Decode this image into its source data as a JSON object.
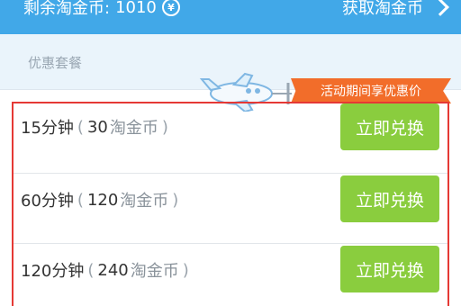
{
  "header": {
    "balance_label": "剩余淘金币:",
    "balance_value": "1010",
    "coin_icon": "yen-coin-icon",
    "get_coins_label": "获取淘金币",
    "arrow_icon": "chevron-right-icon"
  },
  "section": {
    "title": "优惠套餐",
    "promo_text": "活动期间享优惠价"
  },
  "packages": [
    {
      "duration": "15分钟",
      "coins": "30",
      "unit": "淘金币",
      "button": "立即兑换"
    },
    {
      "duration": "60分钟",
      "coins": "120",
      "unit": "淘金币",
      "button": "立即兑换"
    },
    {
      "duration": "120分钟",
      "coins": "240",
      "unit": "淘金币",
      "button": "立即兑换"
    }
  ],
  "colors": {
    "header_bg": "#41a8e8",
    "section_bg": "#eaf4fb",
    "promo_ribbon": "#f26d2a",
    "button_green": "#8acd3e",
    "highlight_border": "#e53935"
  }
}
